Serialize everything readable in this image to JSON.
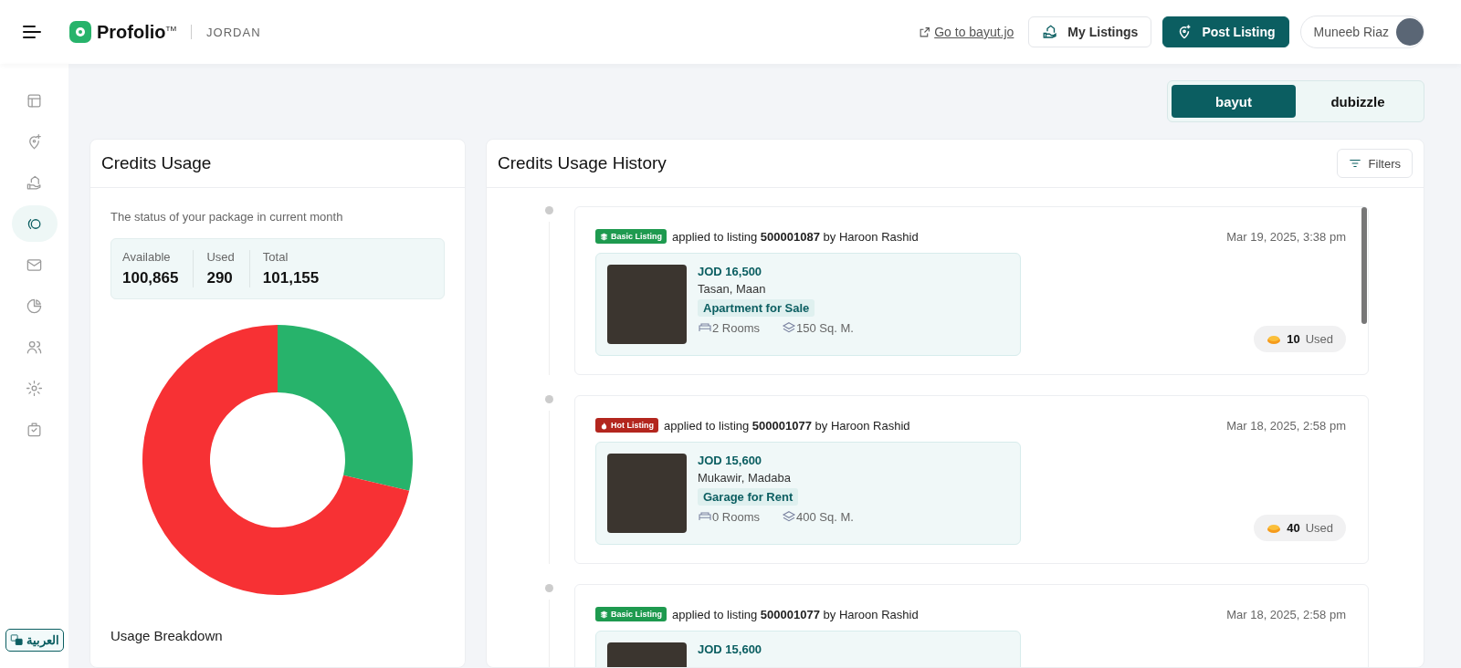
{
  "header": {
    "logo": "Profolio$^{TM}$",
    "country": "JORDAN",
    "site_link": "Go to bayut.jo",
    "my_listings_button": "My Listings",
    "post_listing_button": "Post Listing",
    "user_name": "Muneeb Riaz"
  },
  "sidebar": {
    "items": [
      {
        "selected": false
      },
      {
        "selected": false
      },
      {
        "selected": false
      },
      {
        "selected": true
      },
      {
        "selected": false
      },
      {
        "selected": false
      },
      {
        "selected": false
      },
      {
        "selected": false
      },
      {
        "selected": false
      }
    ],
    "language_button": "العربية"
  },
  "brand_switch": [
    {
      "label": "bayut",
      "selected": true
    },
    {
      "label": "dubizzle",
      "selected": false
    }
  ],
  "credits_usage": {
    "title": "Credits Usage",
    "subtitle": "The status of your package in current month",
    "stats": [
      {
        "label": "Available",
        "value": "100,865"
      },
      {
        "label": "Used",
        "value": "290"
      },
      {
        "label": "Total",
        "value": "101,155"
      }
    ],
    "breakdown_title": "Usage Breakdown"
  },
  "credits_history": {
    "title": "Credits Usage History",
    "filters_button": "Filters",
    "entries": [
      {
        "badge": {
          "kind": "basic",
          "label": "Basic Listing"
        },
        "text": "applied to listing **500001087** by Haroon Rashid",
        "date": "Mar 19, 2025, 3:38 pm",
        "listing": {
          "price": "JOD 16,500",
          "location": "Tasan, Maan",
          "type": "Apartment for Sale",
          "rooms": "2 Rooms",
          "area": "150 Sq. M."
        },
        "credits": {
          "amount": "10",
          "label": "Used"
        }
      },
      {
        "badge": {
          "kind": "hot",
          "label": "Hot Listing"
        },
        "text": "applied to listing **500001077** by Haroon Rashid",
        "date": "Mar 18, 2025, 2:58 pm",
        "listing": {
          "price": "JOD 15,600",
          "location": "Mukawir, Madaba",
          "type": "Garage for Rent",
          "rooms": "0 Rooms",
          "area": "400 Sq. M."
        },
        "credits": {
          "amount": "40",
          "label": "Used"
        }
      },
      {
        "badge": {
          "kind": "basic",
          "label": "Basic Listing"
        },
        "text": "applied to listing **500001077** by Haroon Rashid",
        "date": "Mar 18, 2025, 2:58 pm",
        "listing": {
          "price": "JOD 15,600"
        }
      }
    ]
  }
}
